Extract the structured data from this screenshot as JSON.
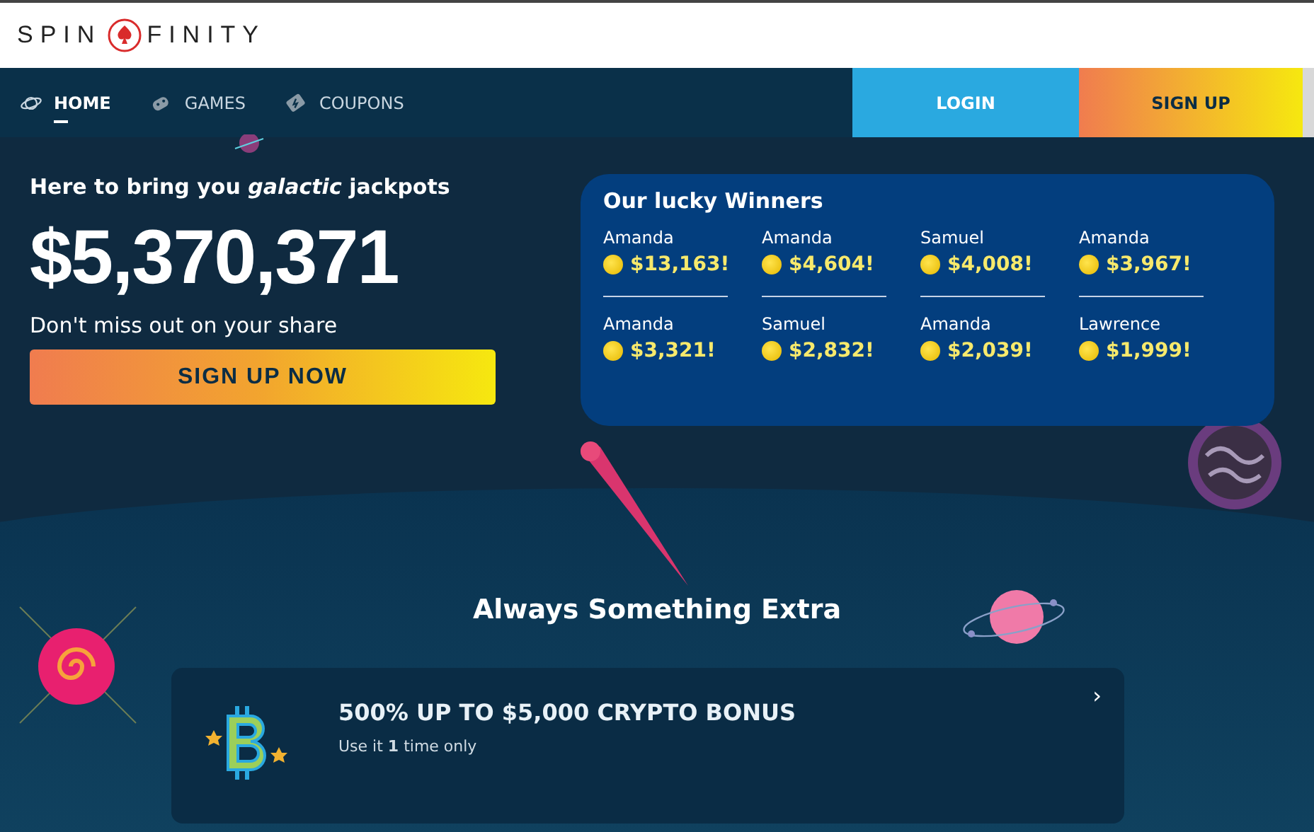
{
  "logo": {
    "left": "SPIN",
    "right": "FINITY"
  },
  "nav": {
    "tabs": [
      {
        "label": "HOME",
        "selected": true
      },
      {
        "label": "GAMES",
        "selected": false
      },
      {
        "label": "COUPONS",
        "selected": false
      }
    ],
    "login": "LOGIN",
    "signup": "SIGN UP"
  },
  "hero": {
    "tagline": "Here to bring you *galactic* jackpots",
    "jackpot": "$5,370,371",
    "subtitle": "Don't miss out on your share",
    "cta": "SIGN UP NOW"
  },
  "winners": {
    "title": "Our lucky Winners",
    "items": [
      {
        "name": "Amanda",
        "amount": "$13,163!"
      },
      {
        "name": "Amanda",
        "amount": "$4,604!"
      },
      {
        "name": "Samuel",
        "amount": "$4,008!"
      },
      {
        "name": "Amanda",
        "amount": "$3,967!"
      },
      {
        "name": "Amanda",
        "amount": "$3,321!"
      },
      {
        "name": "Samuel",
        "amount": "$2,832!"
      },
      {
        "name": "Amanda",
        "amount": "$2,039!"
      },
      {
        "name": "Lawrence",
        "amount": "$1,999!"
      }
    ]
  },
  "extras": {
    "heading": "Always Something Extra",
    "offer": {
      "title": "500% UP TO $5,000 CRYPTO BONUS",
      "note": "Use it **1** time only",
      "arrow": "›"
    }
  }
}
